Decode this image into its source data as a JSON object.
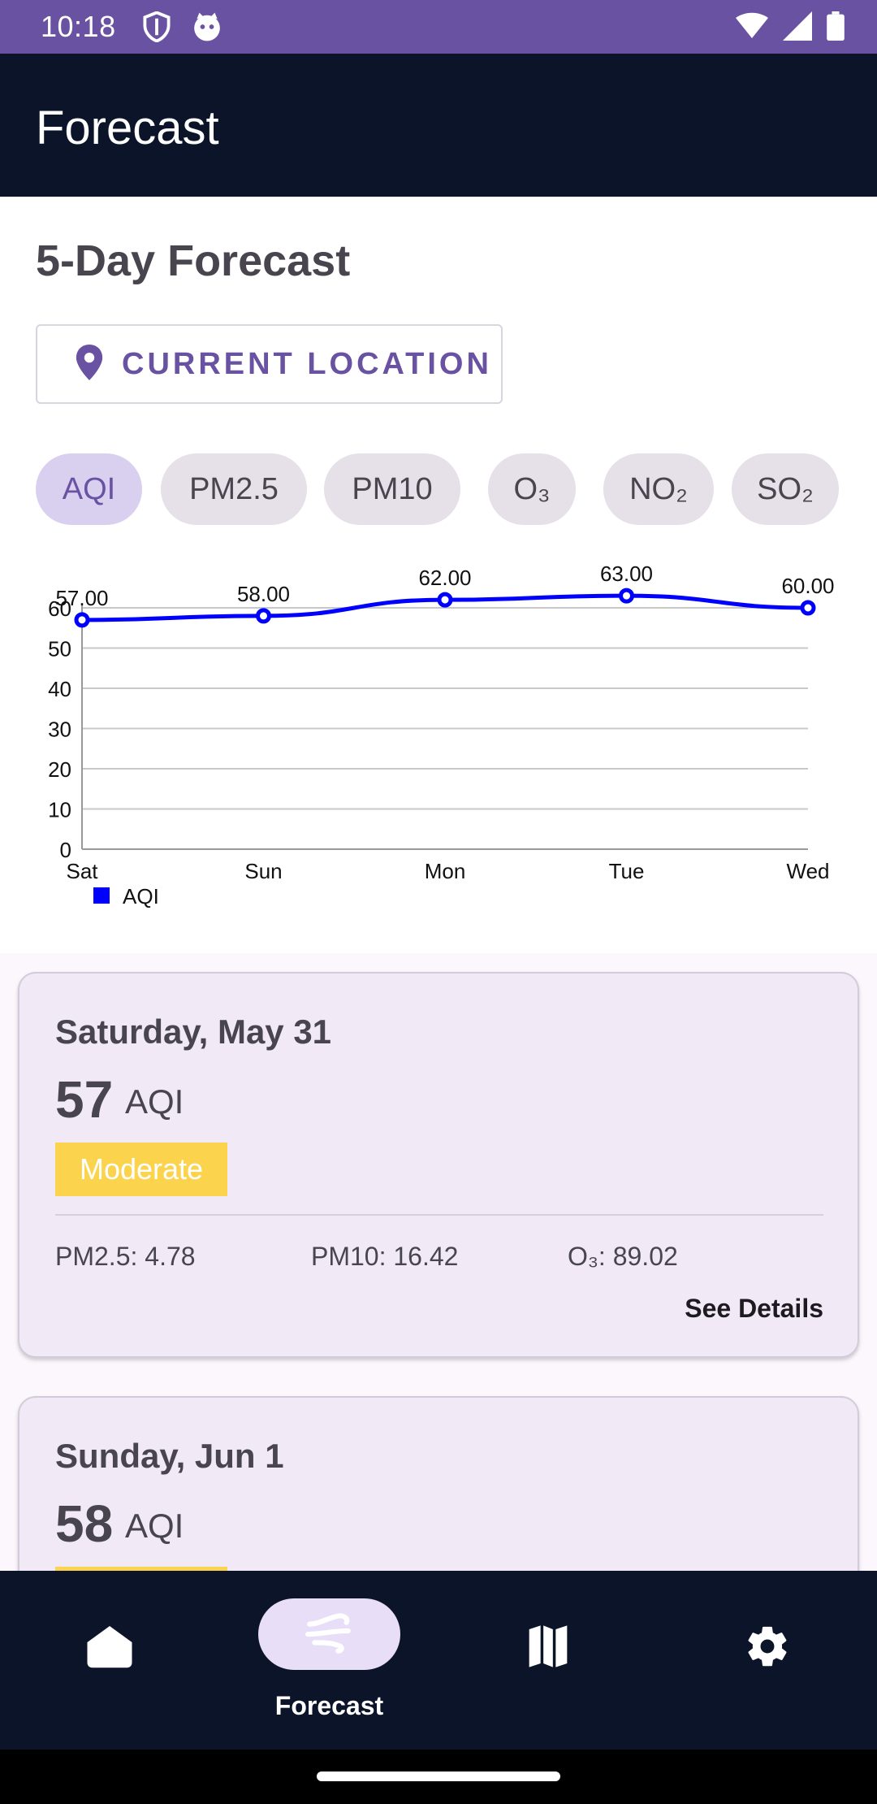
{
  "status_bar": {
    "time": "10:18"
  },
  "app_bar": {
    "title": "Forecast"
  },
  "main": {
    "section_title": "5-Day Forecast",
    "location_button": "CURRENT LOCATION",
    "chips": [
      {
        "label": "AQI",
        "selected": true
      },
      {
        "label": "PM2.5",
        "selected": false
      },
      {
        "label": "PM10",
        "selected": false
      },
      {
        "label": "O₃",
        "selected": false
      },
      {
        "label": "NO₂",
        "selected": false
      },
      {
        "label": "SO₂",
        "selected": false
      }
    ]
  },
  "chart_data": {
    "type": "line",
    "categories": [
      "Sat",
      "Sun",
      "Mon",
      "Tue",
      "Wed"
    ],
    "series": [
      {
        "name": "AQI",
        "values": [
          57,
          58,
          62,
          63,
          60
        ],
        "color": "#0000ff"
      }
    ],
    "data_labels": [
      "57.00",
      "58.00",
      "62.00",
      "63.00",
      "60.00"
    ],
    "y_ticks": [
      "0",
      "10",
      "20",
      "30",
      "40",
      "50",
      "60"
    ],
    "ylim": [
      0,
      60
    ],
    "grid": true,
    "legend_position": "bottom-left"
  },
  "cards": [
    {
      "date": "Saturday, May 31",
      "aqi_value": "57",
      "aqi_unit": "AQI",
      "category": "Moderate",
      "category_color": "#fbd34d",
      "pm25": "PM2.5: 4.78",
      "pm10": "PM10: 16.42",
      "o3": "O₃: 89.02",
      "see_details": "See Details"
    },
    {
      "date": "Sunday, Jun 1",
      "aqi_value": "58",
      "aqi_unit": "AQI"
    }
  ],
  "bottom_nav": {
    "items": [
      {
        "icon": "home-icon"
      },
      {
        "icon": "air-icon",
        "label": "Forecast",
        "selected": true
      },
      {
        "icon": "map-icon"
      },
      {
        "icon": "settings-icon"
      }
    ]
  },
  "colors": {
    "status_bar": "#6a52a3",
    "app_bar": "#0b1428",
    "accent": "#6a52a3",
    "series": "#0000ff"
  }
}
